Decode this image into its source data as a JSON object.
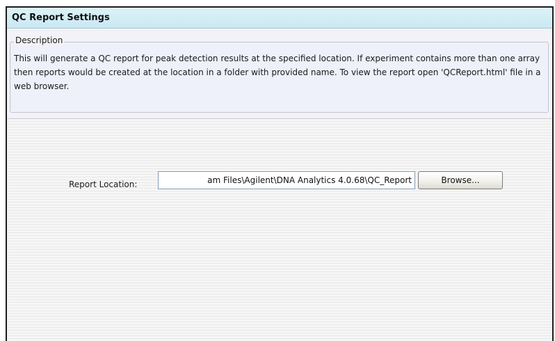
{
  "dialog": {
    "title": "QC Report Settings"
  },
  "description": {
    "legend": "Description",
    "text": "This will generate a QC report for peak detection results at the specified location. If experiment contains more than one array then reports would be created at the location in a folder with provided name. To view the report open 'QCReport.html' file in a web browser."
  },
  "report_location": {
    "label": "Report Location:",
    "value": "am Files\\Agilent\\DNA Analytics 4.0.68\\QC_Report",
    "browse_label": "Browse..."
  },
  "colors": {
    "title_bar": "#d3eef6",
    "description_panel": "#eef0fa",
    "input_border": "#7f9db9"
  }
}
